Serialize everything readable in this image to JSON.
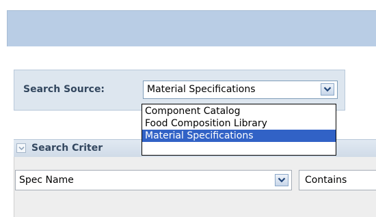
{
  "search_source": {
    "label": "Search Source:",
    "selected_value": "Material Specifications",
    "options": [
      "Component Catalog",
      "Food Composition Library",
      "Material Specifications"
    ],
    "highlighted_option": "Material Specifications"
  },
  "search_criteria": {
    "title": "Search Criter",
    "field_value": "Spec Name",
    "operator_value": "Contains"
  },
  "colors": {
    "topbar": "#b9cde5",
    "panel": "#dde6ef",
    "selected_option": "#3162c6",
    "label_text": "#33475f"
  },
  "icons": {
    "source_dropdown": "chevron-down-icon",
    "field_dropdown": "chevron-down-icon",
    "collapse": "collapse-chevron-icon"
  }
}
